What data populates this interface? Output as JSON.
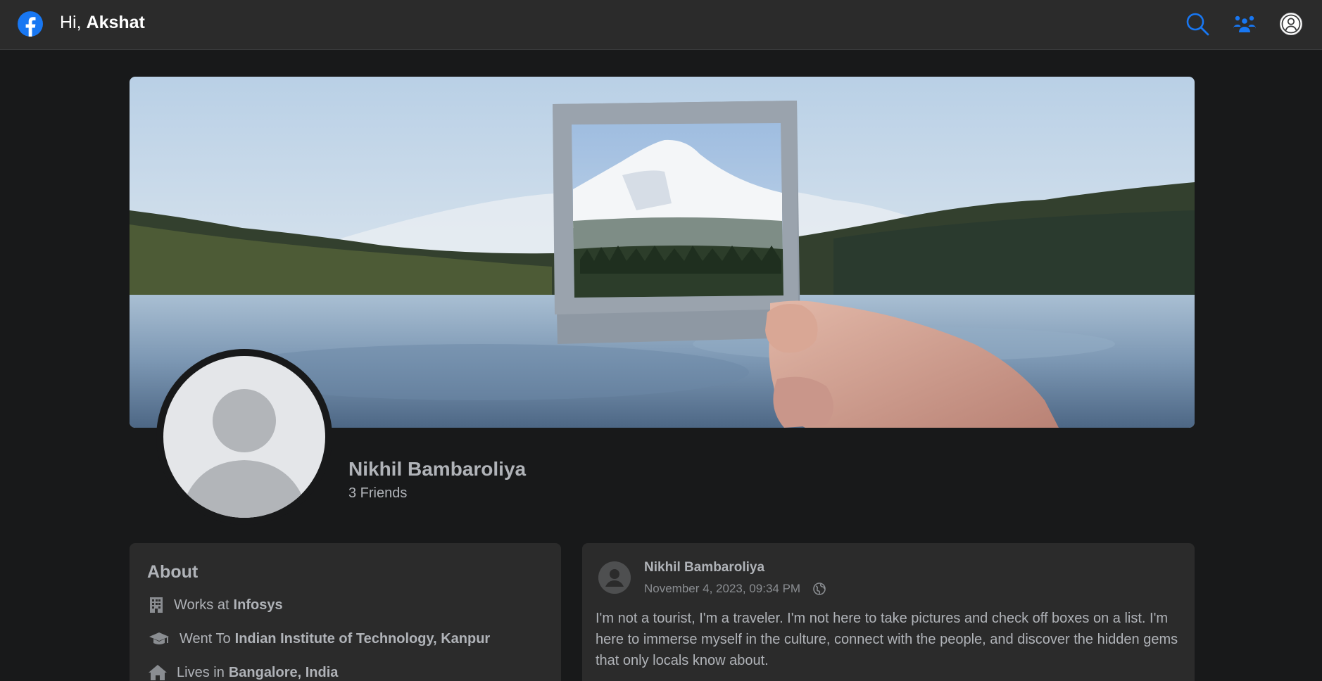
{
  "navbar": {
    "greeting_prefix": "Hi,",
    "user_name": "Akshat",
    "icons": [
      "facebook-logo-icon",
      "search-icon",
      "friends-icon",
      "account-icon"
    ],
    "accent_color": "#1877f2"
  },
  "profile": {
    "name": "Nikhil Bambaroliya",
    "friends": "3 Friends"
  },
  "about": {
    "title": "About",
    "work_prefix": "Works at",
    "work_value": "Infosys",
    "education_prefix": "Went To",
    "education_value": "Indian Institute of Technology, Kanpur",
    "lives_prefix": "Lives in",
    "lives_value": "Bangalore, India"
  },
  "post": {
    "author": "Nikhil Bambaroliya",
    "date": "November 4, 2023, 09:34 PM",
    "text": "I'm not a tourist, I'm a traveler. I'm not here to take pictures and check off boxes on a list. I'm here to immerse myself in the culture, connect with the people, and discover the hidden gems that only locals know about."
  }
}
